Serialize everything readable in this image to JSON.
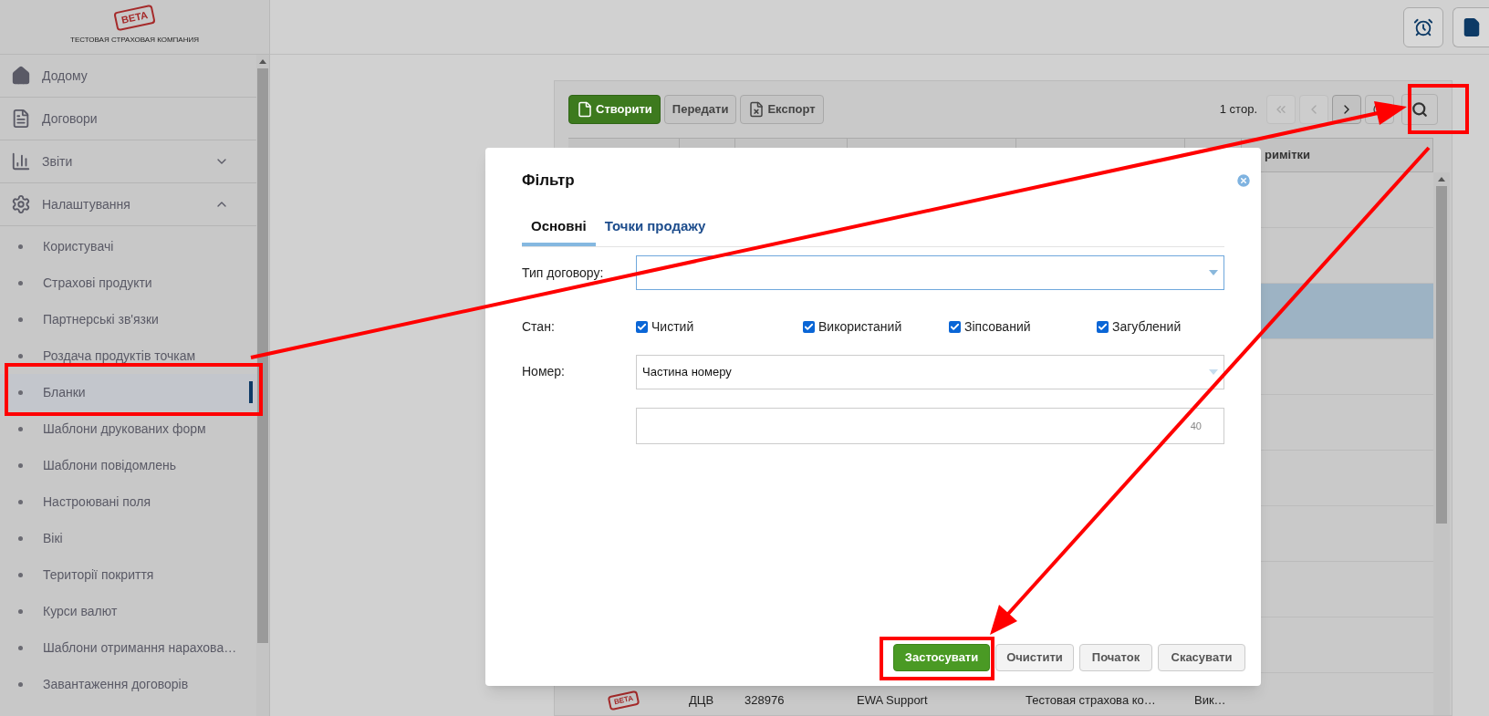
{
  "brand": {
    "stamp": "BETA",
    "company": "ТЕСТОВАЯ СТРАХОВАЯ КОМПАНИЯ"
  },
  "sidebar": {
    "items": [
      {
        "label": "Додому"
      },
      {
        "label": "Договори"
      },
      {
        "label": "Звіти",
        "expanded": false
      },
      {
        "label": "Налаштування",
        "expanded": true,
        "children": [
          {
            "label": "Користувачі",
            "selected": false
          },
          {
            "label": "Страхові продукти",
            "selected": false
          },
          {
            "label": "Партнерські зв'язки",
            "selected": false
          },
          {
            "label": "Роздача продуктів точкам",
            "selected": false
          },
          {
            "label": "Бланки",
            "selected": true
          },
          {
            "label": "Шаблони друкованих форм",
            "selected": false
          },
          {
            "label": "Шаблони повідомлень",
            "selected": false
          },
          {
            "label": "Настроювані поля",
            "selected": false
          },
          {
            "label": "Вікі",
            "selected": false
          },
          {
            "label": "Території покриття",
            "selected": false
          },
          {
            "label": "Курси валют",
            "selected": false
          },
          {
            "label": "Шаблони отримання нарахова…",
            "selected": false
          },
          {
            "label": "Завантаження договорів",
            "selected": false
          }
        ]
      }
    ]
  },
  "toolbar": {
    "buttons": [
      {
        "label": "Створити",
        "kind": "primary"
      },
      {
        "label": "Передати",
        "kind": "plain"
      },
      {
        "label": "Експорт",
        "kind": "export"
      }
    ],
    "page_label": "1 стор.",
    "pager": [
      {
        "disabled": true
      },
      {
        "disabled": true
      },
      {
        "disabled": false
      }
    ]
  },
  "table": {
    "last_heading": "римітки",
    "rows": [
      {
        "selected": false
      },
      {
        "selected": false
      },
      {
        "selected": true
      },
      {
        "selected": false
      },
      {
        "selected": false
      },
      {
        "selected": false
      },
      {
        "selected": false
      },
      {
        "selected": false
      },
      {
        "selected": false
      },
      {
        "selected": false,
        "cells": {
          "stamp": "BETA",
          "type": "ДЦВ",
          "number": "328976",
          "user": "EWA Support",
          "company": "Тестовая страхова ко…",
          "state": "Вик…"
        }
      }
    ]
  },
  "dialog": {
    "title": "Фільтр",
    "tabs": [
      {
        "label": "Основні",
        "selected": true
      },
      {
        "label": "Точки продажу",
        "selected": false
      }
    ],
    "contract_type": {
      "label": "Тип договору:"
    },
    "state": {
      "label": "Стан:",
      "options": [
        {
          "label": "Чистий",
          "checked": true
        },
        {
          "label": "Використаний",
          "checked": true
        },
        {
          "label": "Зіпсований",
          "checked": true
        },
        {
          "label": "Загублений",
          "checked": true
        }
      ]
    },
    "number": {
      "label": "Номер:",
      "mode": "Частина номеру",
      "counter": "40"
    },
    "buttons": [
      {
        "label": "Застосувати",
        "kind": "primary"
      },
      {
        "label": "Очистити",
        "kind": "plain"
      },
      {
        "label": "Початок",
        "kind": "plain"
      },
      {
        "label": "Скасувати",
        "kind": "plain"
      }
    ]
  }
}
